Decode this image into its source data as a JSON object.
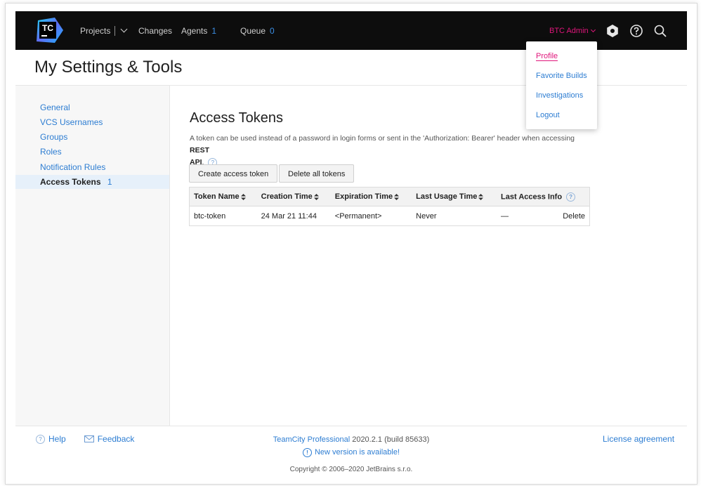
{
  "nav": {
    "projects": "Projects",
    "changes": "Changes",
    "agents": "Agents",
    "agents_count": "1",
    "queue": "Queue",
    "queue_count": "0",
    "user": "BTC Admin",
    "logo_text": "TC"
  },
  "page": {
    "title": "My Settings & Tools"
  },
  "sidebar": {
    "items": [
      {
        "label": "General"
      },
      {
        "label": "VCS Usernames"
      },
      {
        "label": "Groups"
      },
      {
        "label": "Roles"
      },
      {
        "label": "Notification Rules"
      },
      {
        "label": "Access Tokens",
        "count": "1"
      }
    ]
  },
  "main": {
    "heading": "Access Tokens",
    "description": "A token can be used instead of a password in login forms or sent in the 'Authorization: Bearer' header when accessing",
    "description_bold1": "REST",
    "description_bold2": "API",
    "create_button": "Create access token",
    "delete_all_button": "Delete all tokens",
    "table": {
      "headers": [
        "Token Name",
        "Creation Time",
        "Expiration Time",
        "Last Usage Time",
        "Last Access Info"
      ],
      "rows": [
        {
          "name": "btc-token",
          "created": "24 Mar 21 11:44",
          "expires": "<Permanent>",
          "last_usage": "Never",
          "last_access": "—",
          "action": "Delete"
        }
      ]
    }
  },
  "dropdown": {
    "items": [
      "Profile",
      "Favorite Builds",
      "Investigations",
      "Logout"
    ]
  },
  "footer": {
    "help": "Help",
    "feedback": "Feedback",
    "product": "TeamCity Professional",
    "version": "2020.2.1 (build 85633)",
    "new_version": "New version is available!",
    "copyright": "Copyright © 2006–2020 JetBrains s.r.o.",
    "license": "License agreement"
  },
  "colors": {
    "topbar": "#0d0d0d",
    "link": "#2d7dd2",
    "accent": "#e0157b"
  }
}
